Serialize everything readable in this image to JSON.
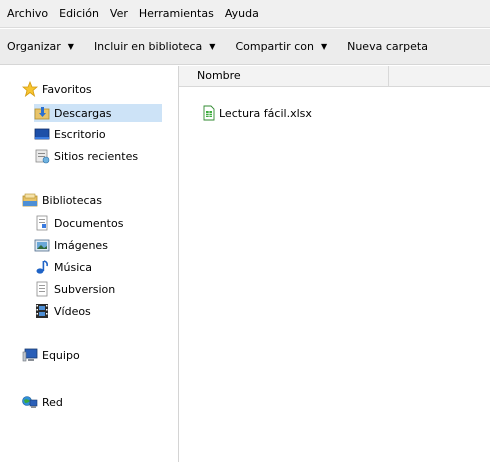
{
  "menubar": {
    "items": [
      "Archivo",
      "Edición",
      "Ver",
      "Herramientas",
      "Ayuda"
    ]
  },
  "toolbar": {
    "organize": "Organizar",
    "include": "Incluir en biblioteca",
    "share": "Compartir con",
    "new_folder": "Nueva carpeta"
  },
  "nav": {
    "favorites": {
      "label": "Favoritos",
      "items": [
        "Descargas",
        "Escritorio",
        "Sitios recientes"
      ]
    },
    "libraries": {
      "label": "Bibliotecas",
      "items": [
        "Documentos",
        "Imágenes",
        "Música",
        "Subversion",
        "Vídeos"
      ]
    },
    "computer": "Equipo",
    "network": "Red"
  },
  "list": {
    "header_name": "Nombre",
    "files": [
      {
        "name": "Lectura fácil.xlsx",
        "icon": "excel-file-icon"
      }
    ]
  },
  "colors": {
    "selection": "#cde3f7",
    "menubar_bg": "#f0f0f0",
    "toolbar_bg": "#ececec"
  }
}
